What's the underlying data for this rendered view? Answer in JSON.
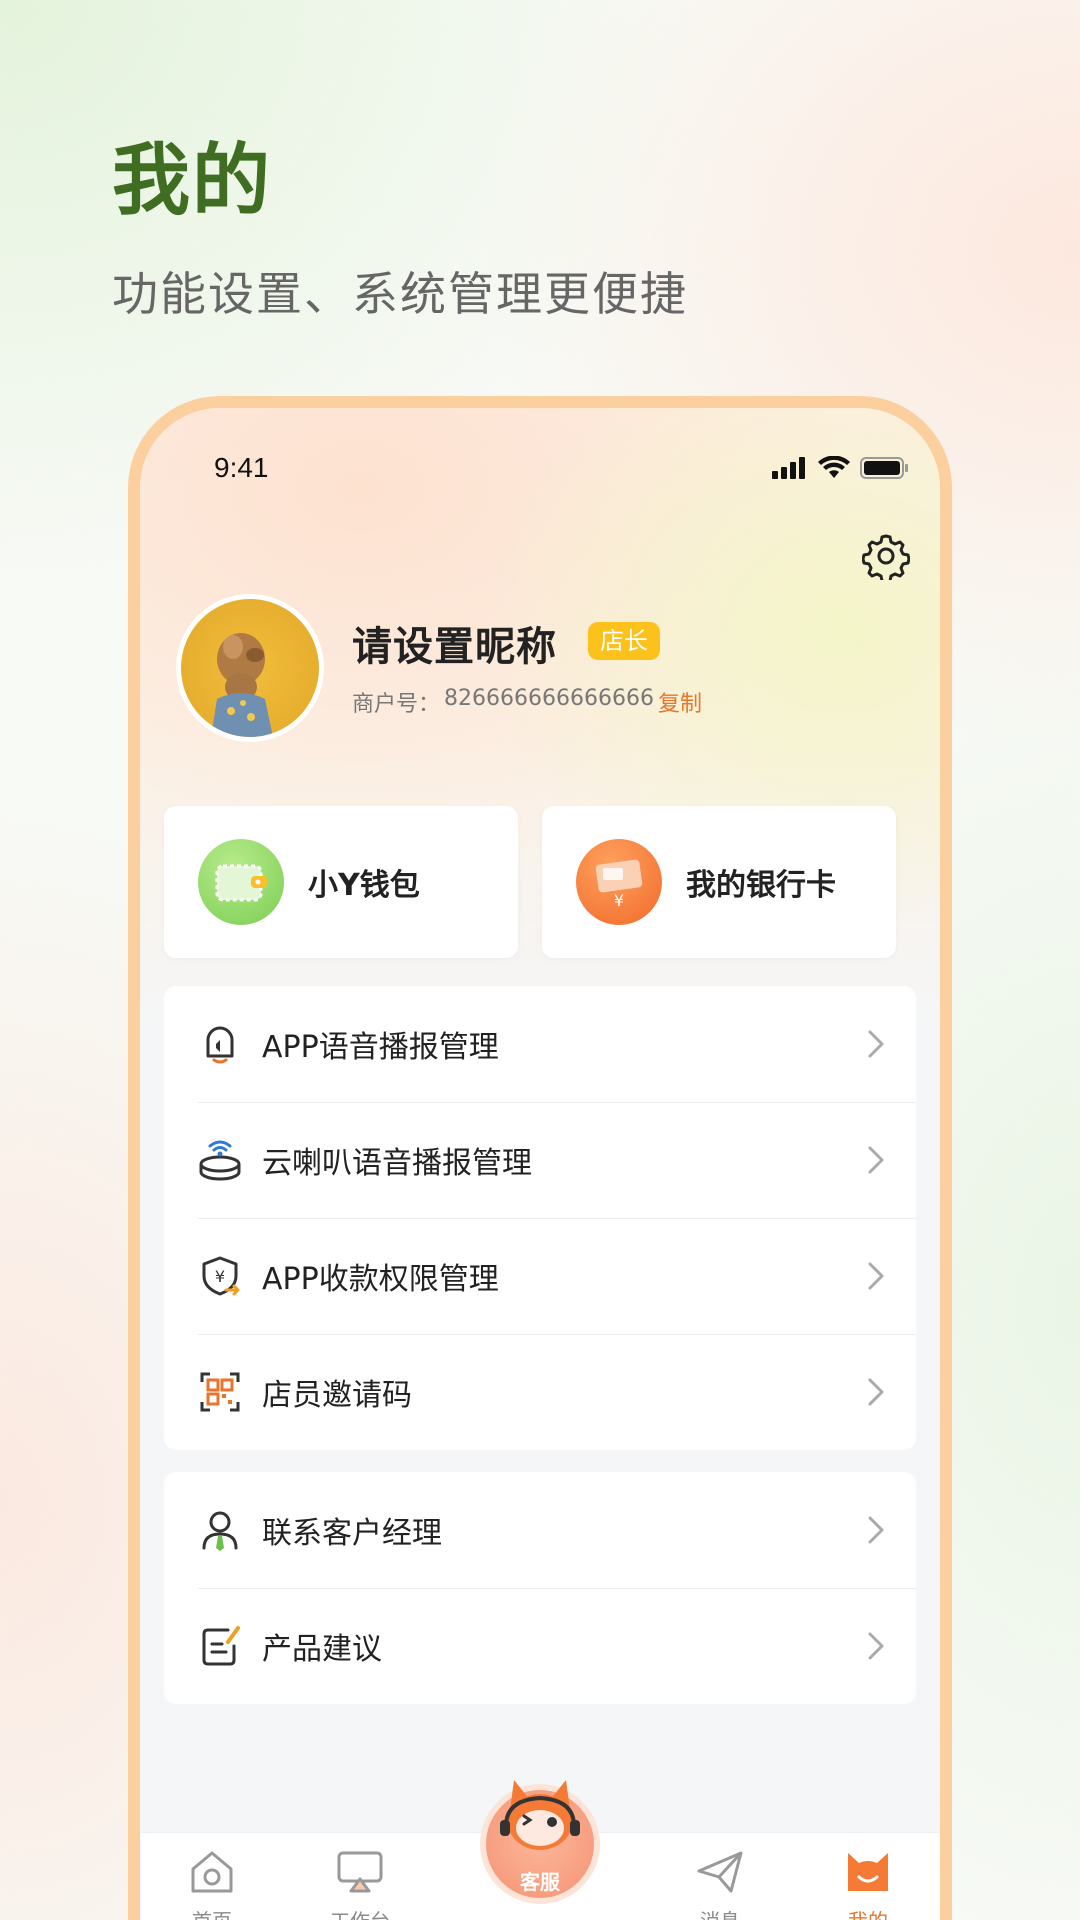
{
  "hero": {
    "title": "我的",
    "subtitle": "功能设置、系统管理更便捷"
  },
  "status_bar": {
    "time": "9:41"
  },
  "profile": {
    "nickname": "请设置昵称",
    "role_badge": "店长",
    "merchant_label": "商户号：",
    "merchant_id": "826666666666666",
    "copy_label": "复制"
  },
  "quick_cards": [
    {
      "label": "小Y钱包",
      "icon": "wallet-icon",
      "color": "#8fd66a"
    },
    {
      "label": "我的银行卡",
      "icon": "bank-card-icon",
      "color": "#f47a35"
    }
  ],
  "menu_group_1": [
    {
      "label": "APP语音播报管理",
      "icon": "voice-broadcast-icon"
    },
    {
      "label": "云喇叭语音播报管理",
      "icon": "cloud-speaker-icon"
    },
    {
      "label": "APP收款权限管理",
      "icon": "payment-permission-icon"
    },
    {
      "label": "店员邀请码",
      "icon": "qr-code-icon"
    }
  ],
  "menu_group_2": [
    {
      "label": "联系客户经理",
      "icon": "account-manager-icon"
    },
    {
      "label": "产品建议",
      "icon": "feedback-icon"
    }
  ],
  "tab_bar": {
    "items": [
      {
        "label": "首页",
        "icon": "home-icon"
      },
      {
        "label": "工作台",
        "icon": "workbench-icon"
      },
      {
        "label": "客服",
        "icon": "customer-service-icon"
      },
      {
        "label": "消息",
        "icon": "message-icon"
      },
      {
        "label": "我的",
        "icon": "profile-icon",
        "active": true
      }
    ]
  },
  "colors": {
    "accent": "#e9742b",
    "hero_title": "#3f6e22",
    "badge": "#fcc21b",
    "phone_frame": "#fbcf9e"
  }
}
